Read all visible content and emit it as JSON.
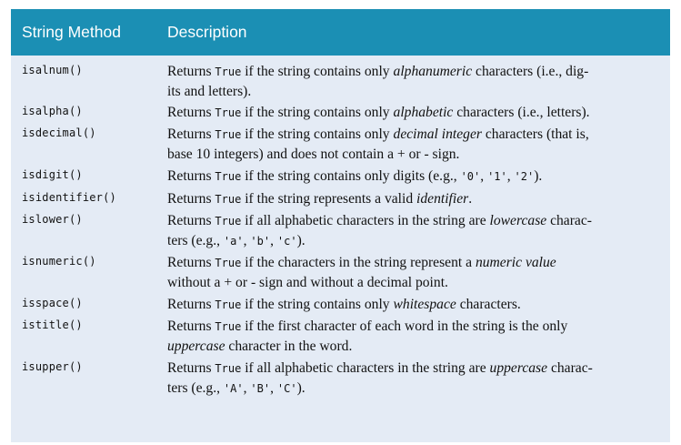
{
  "table": {
    "headers": {
      "method": "String Method",
      "description": "Description"
    },
    "rows": [
      {
        "method": "isalnum()",
        "d": [
          "Returns ",
          "True",
          " if the string contains only ",
          "alphanumeric",
          " characters (i.e., dig-",
          "its and letters)."
        ]
      },
      {
        "method": "isalpha()",
        "d": [
          "Returns ",
          "True",
          " if the string contains only ",
          "alphabetic",
          " characters (i.e., letters)."
        ]
      },
      {
        "method": "isdecimal()",
        "d": [
          "Returns ",
          "True",
          " if the string contains only ",
          "decimal integer",
          " characters (that is,",
          "base 10 integers) and does not contain a + or - sign."
        ]
      },
      {
        "method": "isdigit()",
        "d": [
          "Returns ",
          "True",
          " if the string contains only digits (e.g., ",
          "'0'",
          ", ",
          "'1'",
          ", ",
          "'2'",
          ")."
        ]
      },
      {
        "method": "isidentifier()",
        "d": [
          "Returns ",
          "True",
          " if the string represents a valid ",
          "identifier",
          "."
        ]
      },
      {
        "method": "islower()",
        "d": [
          "Returns ",
          "True",
          " if all alphabetic characters in the string are ",
          "lowercase",
          " charac-",
          "ters (e.g., ",
          "'a'",
          ", ",
          "'b'",
          ", ",
          "'c'",
          ")."
        ]
      },
      {
        "method": "isnumeric()",
        "d": [
          "Returns ",
          "True",
          " if the characters in the string represent a ",
          "numeric value",
          "without a + or - sign and without a decimal point."
        ]
      },
      {
        "method": "isspace()",
        "d": [
          "Returns ",
          "True",
          " if the string contains only ",
          "whitespace",
          " characters."
        ]
      },
      {
        "method": "istitle()",
        "d": [
          "Returns ",
          "True",
          " if the first character of each word in the string is the only",
          "uppercase",
          " character in the word."
        ]
      },
      {
        "method": "isupper()",
        "d": [
          "Returns ",
          "True",
          " if all alphabetic characters in the string are ",
          "uppercase",
          " charac-",
          "ters (e.g., ",
          "'A'",
          ", ",
          "'B'",
          ", ",
          "'C'",
          ")."
        ]
      }
    ]
  }
}
